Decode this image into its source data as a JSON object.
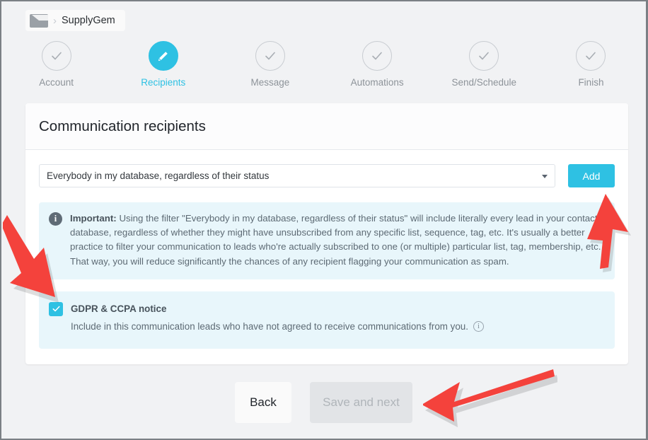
{
  "breadcrumb": {
    "icon": "envelope-icon",
    "separator": "›",
    "app_name": "SupplyGem"
  },
  "stepper": {
    "steps": [
      {
        "label": "Account",
        "icon": "check-icon",
        "state": "complete"
      },
      {
        "label": "Recipients",
        "icon": "pencil-icon",
        "state": "active"
      },
      {
        "label": "Message",
        "icon": "check-icon",
        "state": "complete"
      },
      {
        "label": "Automations",
        "icon": "check-icon",
        "state": "complete"
      },
      {
        "label": "Send/Schedule",
        "icon": "check-icon",
        "state": "complete"
      },
      {
        "label": "Finish",
        "icon": "check-icon",
        "state": "complete"
      }
    ],
    "active_color": "#2ec1e3",
    "inactive_color": "#8d9399"
  },
  "card": {
    "title": "Communication recipients",
    "filter_select": {
      "value": "Everybody in my database, regardless of their status",
      "icon": "chevron-down-icon"
    },
    "add_button": {
      "label": "Add",
      "color": "#2ec1e3"
    },
    "info_panel": {
      "icon": "info-filled-icon",
      "lead": "Important:",
      "body": " Using the filter \"Everybody in my database, regardless of their status\" will include literally every lead in your contacts database, regardless of whether they might have unsubscribed from any specific list, sequence, tag, etc. It's usually a better practice to filter your communication to leads who're actually subscribed to one (or multiple) particular list, tag, membership, etc. That way, you will reduce significantly the chances of any recipient flagging your communication as spam.",
      "background": "#e8f6fb"
    },
    "gdpr_panel": {
      "checkbox": {
        "checked": true,
        "icon": "check-icon",
        "color": "#2ec1e3"
      },
      "title": "GDPR & CCPA notice",
      "description": "Include in this communication leads who have not agreed to receive communications from you.",
      "help_icon": "info-outline-icon",
      "background": "#e8f6fb"
    }
  },
  "footer": {
    "back_label": "Back",
    "next_label": "Save and next",
    "next_disabled": true
  },
  "annotations": {
    "color": "#f4423c",
    "arrows": [
      {
        "name": "arrow-to-add-button",
        "points_to": "Add button",
        "direction": "up"
      },
      {
        "name": "arrow-to-gdpr-checkbox",
        "points_to": "GDPR checkbox",
        "direction": "down-right"
      },
      {
        "name": "arrow-to-save-and-next",
        "points_to": "Save and next",
        "direction": "left"
      }
    ]
  }
}
